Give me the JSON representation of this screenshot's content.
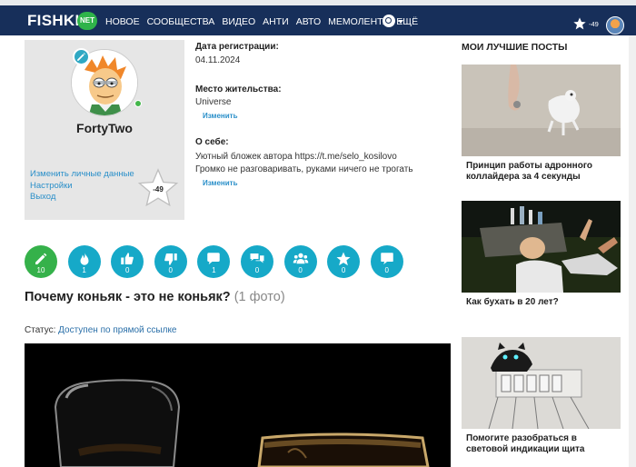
{
  "nav": {
    "logo": "FISHKI",
    "logo_badge": "NET",
    "menu": [
      "НОВОЕ",
      "СООБЩЕСТВА",
      "ВИДЕО",
      "АНТИ",
      "АВТО",
      "МЕМОЛЕНТА",
      "ЕЩЁ"
    ],
    "rating": "-49"
  },
  "profile": {
    "username": "FortyTwo",
    "links": [
      "Изменить личные данные",
      "Настройки",
      "Выход"
    ],
    "rating": "-49"
  },
  "info": {
    "reg_label": "Дата регистрации:",
    "reg_value": "04.11.2024",
    "place_label": "Место жительства:",
    "place_value": "Universe",
    "edit_label": "Изменить",
    "about_label": "О себе:",
    "about_line1": "Уютный бложек автора https://t.me/selo_kosilovo",
    "about_line2": "Громко не разговаривать, руками ничего не трогать"
  },
  "stats": [
    {
      "icon": "pencil-icon",
      "count": "10"
    },
    {
      "icon": "fire-icon",
      "count": "1"
    },
    {
      "icon": "thumbs-up-icon",
      "count": "0"
    },
    {
      "icon": "thumbs-down-icon",
      "count": "0"
    },
    {
      "icon": "comment-icon",
      "count": "1"
    },
    {
      "icon": "comments-icon",
      "count": "0"
    },
    {
      "icon": "users-icon",
      "count": "0"
    },
    {
      "icon": "star-icon",
      "count": "0"
    },
    {
      "icon": "message-icon",
      "count": "0"
    }
  ],
  "post": {
    "title": "Почему коньяк - это не коньяк?",
    "photo_count": "(1 фото)",
    "status_label": "Статус:",
    "status_value": "Доступен по прямой ссылке"
  },
  "sidebar": {
    "heading": "МОИ ЛУЧШИЕ ПОСТЫ",
    "posts": [
      {
        "title": "Принцип работы адронного коллайдера за 4 секунды"
      },
      {
        "title": "Как бухать в 20 лет?"
      },
      {
        "title": "Помогите разобраться в световой индикации щита"
      }
    ]
  },
  "colors": {
    "nav_bg": "#172f5a",
    "accent_blue": "#16a9c8",
    "accent_green": "#35b14a",
    "link": "#2a8fc9"
  }
}
